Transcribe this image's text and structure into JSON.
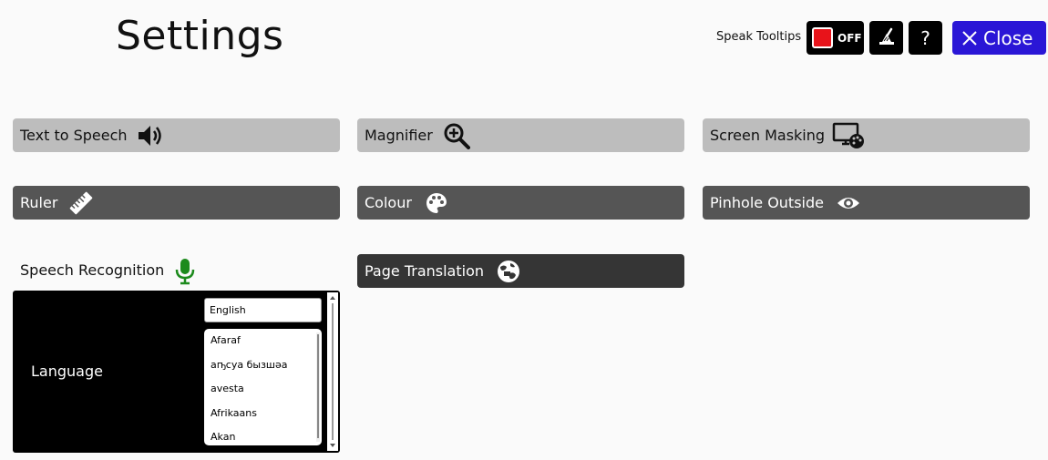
{
  "header": {
    "title": "Settings",
    "speak_tooltips_label": "Speak Tooltips",
    "toggle_state": "OFF",
    "help_label": "?",
    "close_label": "Close"
  },
  "tiles": {
    "text_to_speech": "Text to Speech",
    "magnifier": "Magnifier",
    "screen_masking": "Screen Masking",
    "ruler": "Ruler",
    "colour": "Colour",
    "pinhole_outside": "Pinhole Outside",
    "page_translation": "Page Translation"
  },
  "speech_recognition": {
    "label": "Speech Recognition",
    "language_label": "Language",
    "selected_language": "English",
    "options": [
      "Afaraf",
      "аҧсуа бызшәа",
      "avesta",
      "Afrikaans",
      "Akan"
    ]
  },
  "colors": {
    "close_bg": "#2a16d6",
    "toggle_knob": "#e8131a",
    "mic": "#1c8a1c",
    "tile_light": "#bdbdbd",
    "tile_dark": "#555555"
  }
}
